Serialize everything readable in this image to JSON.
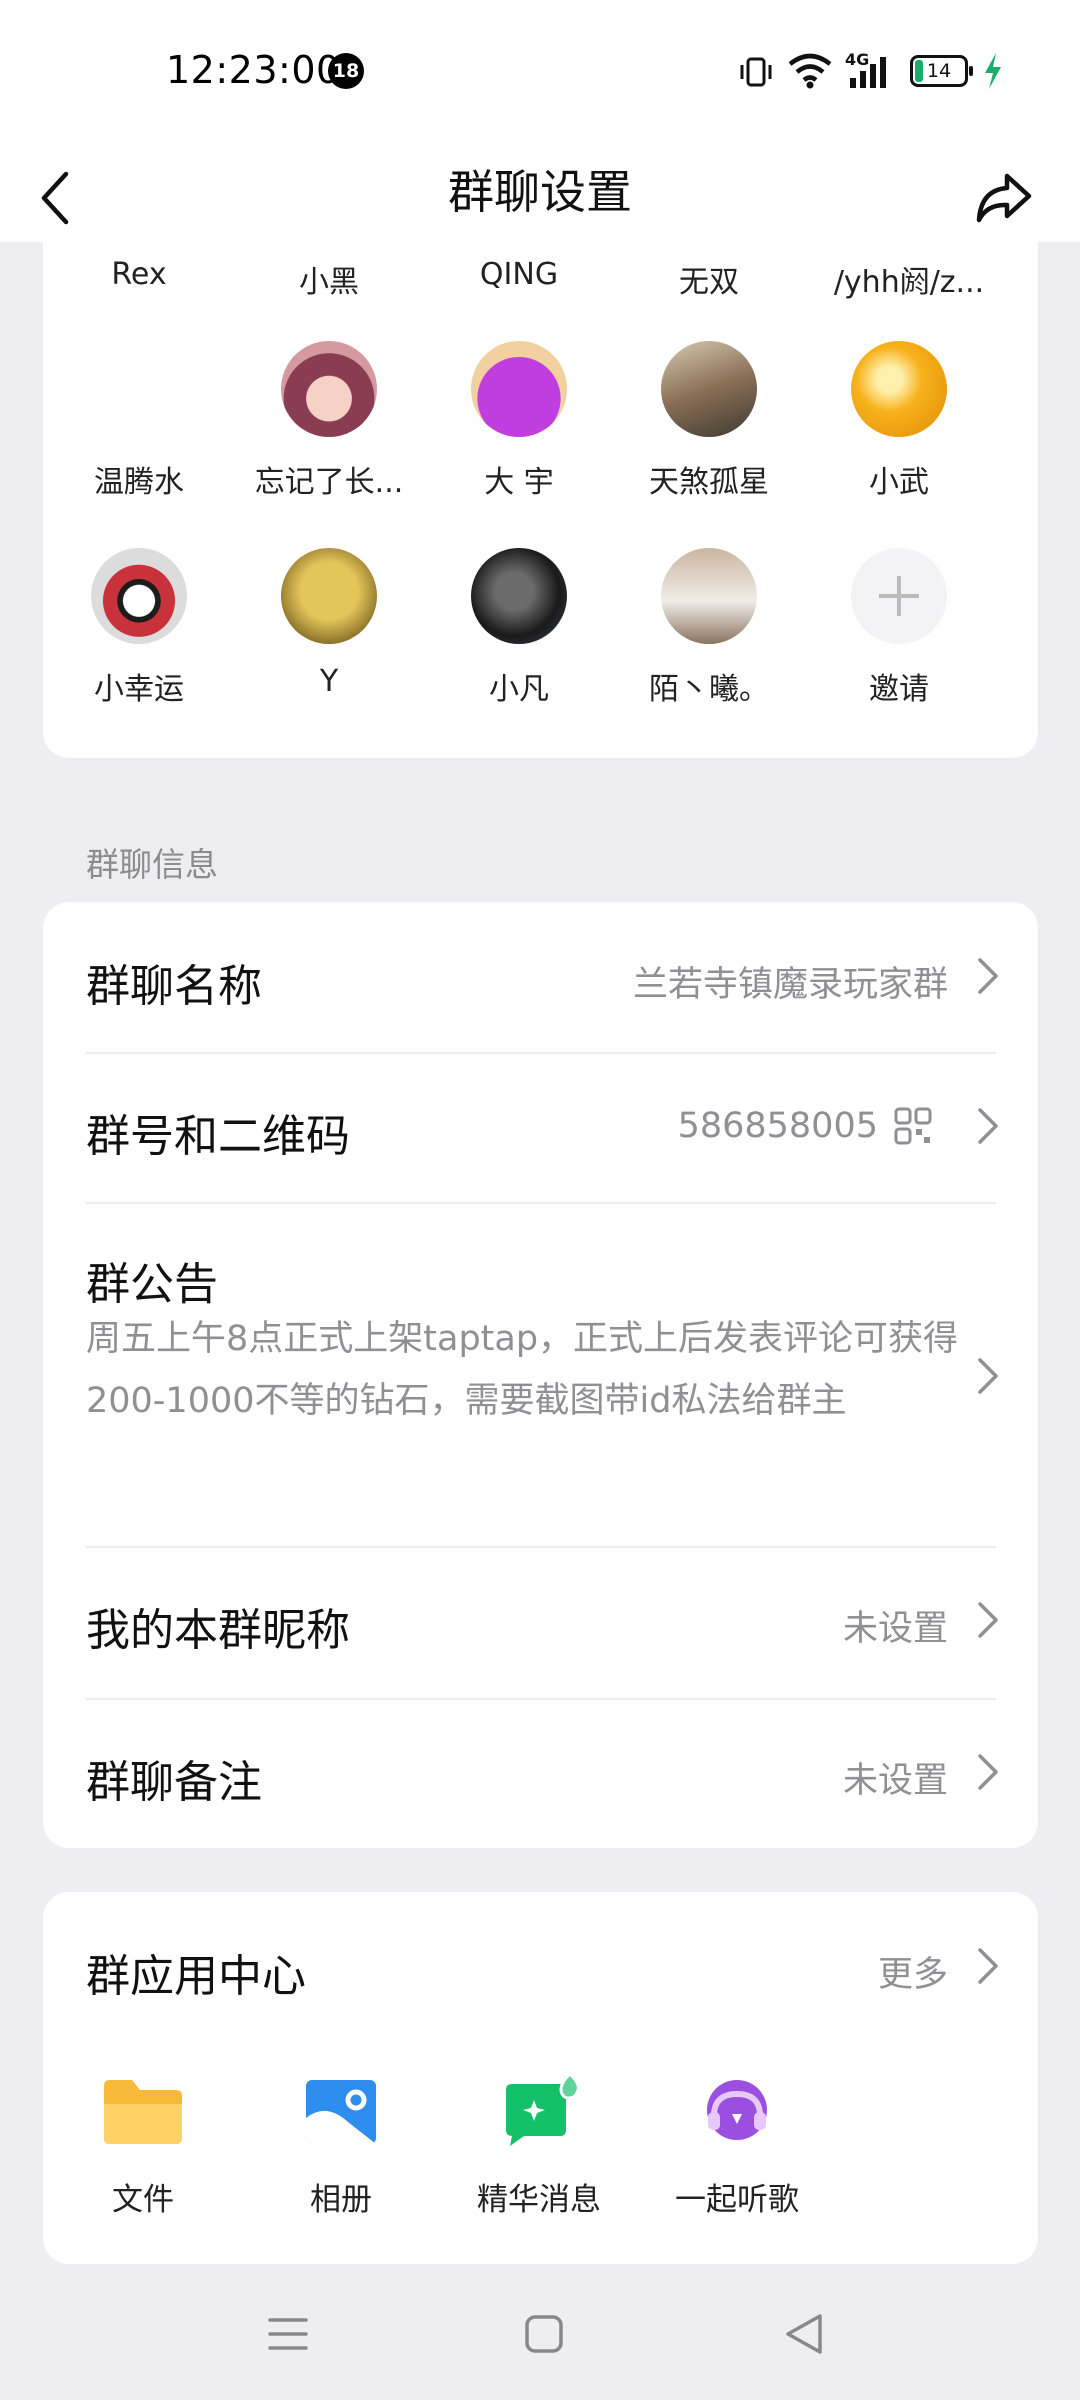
{
  "status_bar": {
    "time": "12:23:00",
    "notification_count": "18",
    "network": "4G",
    "battery": "14"
  },
  "header": {
    "title": "群聊设置"
  },
  "members": {
    "row1_names": [
      "Rex",
      "小黑",
      "QING",
      "无双",
      "/yhh阏/z..."
    ],
    "row2": [
      {
        "name": "温腾水",
        "avatar_color": "#ffffff"
      },
      {
        "name": "忘记了长...",
        "avatar_color": "#c98a8a"
      },
      {
        "name": "大  宇",
        "avatar_color": "#b640d6"
      },
      {
        "name": "天煞孤星",
        "avatar_color": "#8a7a66"
      },
      {
        "name": "小武",
        "avatar_color": "#f2a30f"
      }
    ],
    "row3": [
      {
        "name": "小幸运",
        "avatar_color": "#d9d9d9"
      },
      {
        "name": "Y",
        "avatar_color": "#c9a63a"
      },
      {
        "name": "小凡",
        "avatar_color": "#3d3d3d"
      },
      {
        "name": "陌丶曦。",
        "avatar_color": "#b9a08c"
      },
      {
        "name": "邀请",
        "avatar_color": "#f3f3f5"
      }
    ]
  },
  "info_section": {
    "label": "群聊信息",
    "group_name": {
      "title": "群聊名称",
      "value": "兰若寺镇魔录玩家群"
    },
    "group_id": {
      "title": "群号和二维码",
      "value": "586858005"
    },
    "notice": {
      "title": "群公告",
      "text": "周五上午8点正式上架taptap，正式上后发表评论可获得200-1000不等的钻石，需要截图带id私法给群主"
    },
    "nickname": {
      "title": "我的本群昵称",
      "value": "未设置"
    },
    "remark": {
      "title": "群聊备注",
      "value": "未设置"
    }
  },
  "apps_section": {
    "title": "群应用中心",
    "more": "更多",
    "apps": [
      {
        "label": "文件",
        "icon": "folder-icon"
      },
      {
        "label": "相册",
        "icon": "album-icon"
      },
      {
        "label": "精华消息",
        "icon": "essence-message-icon"
      },
      {
        "label": "一起听歌",
        "icon": "listen-together-icon"
      }
    ]
  },
  "colors": {
    "accent_green": "#1aad6b",
    "value_gray": "#8f8f94",
    "page_bg": "#eeeef2"
  }
}
